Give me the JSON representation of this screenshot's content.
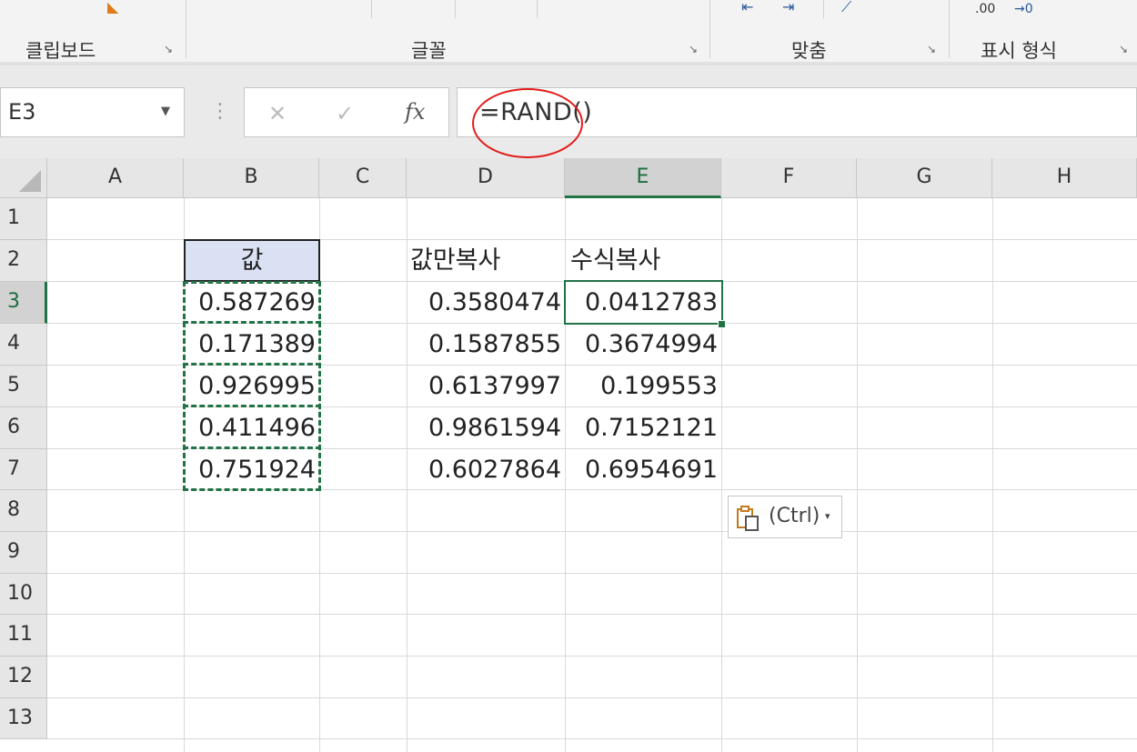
{
  "ribbon": {
    "groups": [
      {
        "label": "클립보드"
      },
      {
        "label": "글꼴"
      },
      {
        "label": "맞춤"
      },
      {
        "label": "표시 형식"
      }
    ],
    "launcher_glyph": "↘",
    "number_format_hint": ".00",
    "number_format_hint2": "→0"
  },
  "name_box": {
    "value": "E3",
    "arrow": "▼"
  },
  "formula_bar": {
    "cancel_glyph": "✕",
    "enter_glyph": "✓",
    "fx_label": "fx",
    "formula": "=RAND()",
    "dots": "⋮"
  },
  "sheet": {
    "columns": [
      "A",
      "B",
      "C",
      "D",
      "E",
      "F",
      "G",
      "H"
    ],
    "rows": [
      "1",
      "2",
      "3",
      "4",
      "5",
      "6",
      "7",
      "8",
      "9",
      "10",
      "11",
      "12",
      "13"
    ],
    "selected_column": "E",
    "selected_row": "3",
    "cells": {
      "B2": "값",
      "D2": "값만복사",
      "E2": "수식복사",
      "B3": "0.587269",
      "B4": "0.171389",
      "B5": "0.926995",
      "B6": "0.411496",
      "B7": "0.751924",
      "D3": "0.3580474",
      "D4": "0.1587855",
      "D5": "0.6137997",
      "D6": "0.9861594",
      "D7": "0.6027864",
      "E3": "0.0412783",
      "E4": "0.3674994",
      "E5": "0.199553",
      "E6": "0.7152121",
      "E7": "0.6954691"
    }
  },
  "paste_options": {
    "label": "(Ctrl)",
    "caret": "▾",
    "icon": "clipboard-paste-icon"
  },
  "colors": {
    "accent": "#217346",
    "header_fill": "#d9e1f2",
    "annotation": "#e21b1b"
  }
}
